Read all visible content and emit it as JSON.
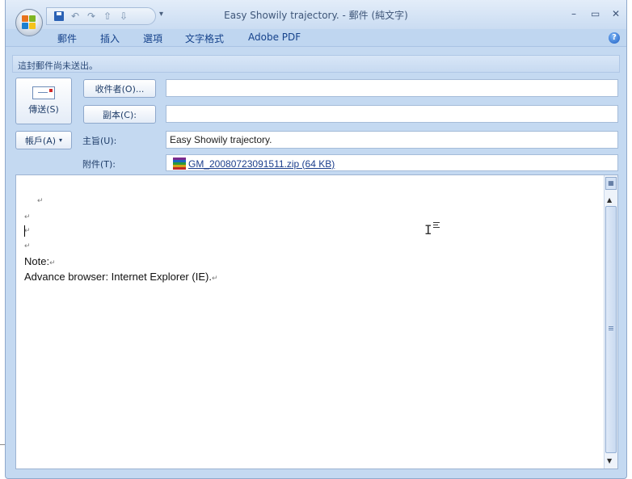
{
  "window": {
    "title": "Easy Showily trajectory. - 郵件 (純文字)",
    "minimize_label": "–",
    "maximize_label": "▭",
    "close_label": "✕"
  },
  "qat": {
    "dropdown_glyph": "▾"
  },
  "ribbon": {
    "tabs": [
      "郵件",
      "插入",
      "選項",
      "文字格式",
      "Adobe PDF"
    ],
    "help_glyph": "?"
  },
  "infobar": {
    "text": "這封郵件尚未送出。"
  },
  "compose": {
    "send_label": "傳送(S)",
    "to_button_label": "收件者(O)...",
    "cc_button_label": "副本(C):",
    "account_label": "帳戶(A)",
    "account_caret": "▾",
    "subject_label": "主旨(U):",
    "attach_label": "附件(T):",
    "to_value": "",
    "cc_value": "",
    "subject_value": "Easy Showily trajectory.",
    "attachment": "GM_20080723091511.zip (64 KB)"
  },
  "body": {
    "pilcrow": "↵",
    "note_line": "Note:",
    "browser_line": "Advance browser: Internet Explorer (IE)."
  },
  "colors": {
    "chrome": "#c4d9f1",
    "tab_text": "#15428b",
    "link": "#1b3e8c"
  }
}
